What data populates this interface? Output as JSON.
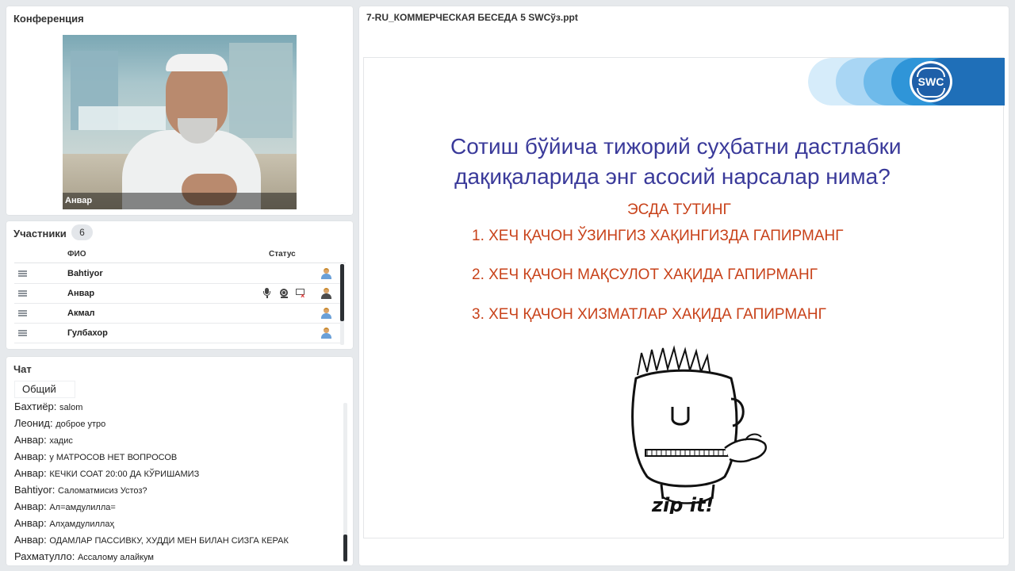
{
  "conference": {
    "title": "Конференция",
    "video_name": "Анвар"
  },
  "participants": {
    "title": "Участники",
    "count": "6",
    "col_name": "ФИО",
    "col_status": "Статус",
    "rows": [
      {
        "name": "Bahtiyor",
        "mic": false,
        "cam": false,
        "screen": false
      },
      {
        "name": "Анвар",
        "mic": true,
        "cam": true,
        "screen": true
      },
      {
        "name": "Акмал",
        "mic": false,
        "cam": false,
        "screen": false
      },
      {
        "name": "Гулбахор",
        "mic": false,
        "cam": false,
        "screen": false
      }
    ]
  },
  "chat": {
    "title": "Чат",
    "tab": "Общий",
    "messages": [
      {
        "author": "Бахтиёр:",
        "text": "salom"
      },
      {
        "author": "Леонид:",
        "text": "доброе утро"
      },
      {
        "author": "Анвар:",
        "text": "хадис"
      },
      {
        "author": "Анвар:",
        "text": "у МАТРОСОВ НЕТ ВОПРОСОВ"
      },
      {
        "author": "Анвар:",
        "text": "КЕЧКИ СОАТ 20:00 ДА КЎРИШАМИЗ"
      },
      {
        "author": "Bahtiyor:",
        "text": "Саломатмисиз Устоз?"
      },
      {
        "author": "Анвар:",
        "text": "Ал=амдулилла="
      },
      {
        "author": "Анвар:",
        "text": "Алҳамдулиллаҳ"
      },
      {
        "author": "Анвар:",
        "text": "ОДАМЛАР ПАССИВКУ, ХУДДИ МЕН БИЛАН СИЗГА КЕРАК"
      },
      {
        "author": "Рахматулло:",
        "text": "Ассалому алайкум"
      }
    ]
  },
  "presentation": {
    "file_title": "7-RU_КОММЕРЧЕСКАЯ БЕСЕДА 5 SWCўз.ppt",
    "logo_text": "SWC",
    "question_line1": "Сотиш бўйича тижорий суҳбатни дастлабки",
    "question_line2": "дақиқаларида энг асосий нарсалар нима?",
    "remember": "ЭСДА ТУТИНГ",
    "rules": [
      "1. ХЕЧ ҚАЧОН ЎЗИНГИЗ ХАҚИНГИЗДА ГАПИРМАНГ",
      "2. ХЕЧ ҚАЧОН МАҚСУЛОТ ХАҚИДА ГАПИРМАНГ",
      "3. ХЕЧ ҚАЧОН ХИЗМАТЛАР ХАҚИДА ГАПИРМАНГ"
    ],
    "cartoon_caption": "zip it!",
    "colors": {
      "question": "#3a3a9a",
      "rules": "#c8421a",
      "logo": "#1f5fa8"
    }
  }
}
